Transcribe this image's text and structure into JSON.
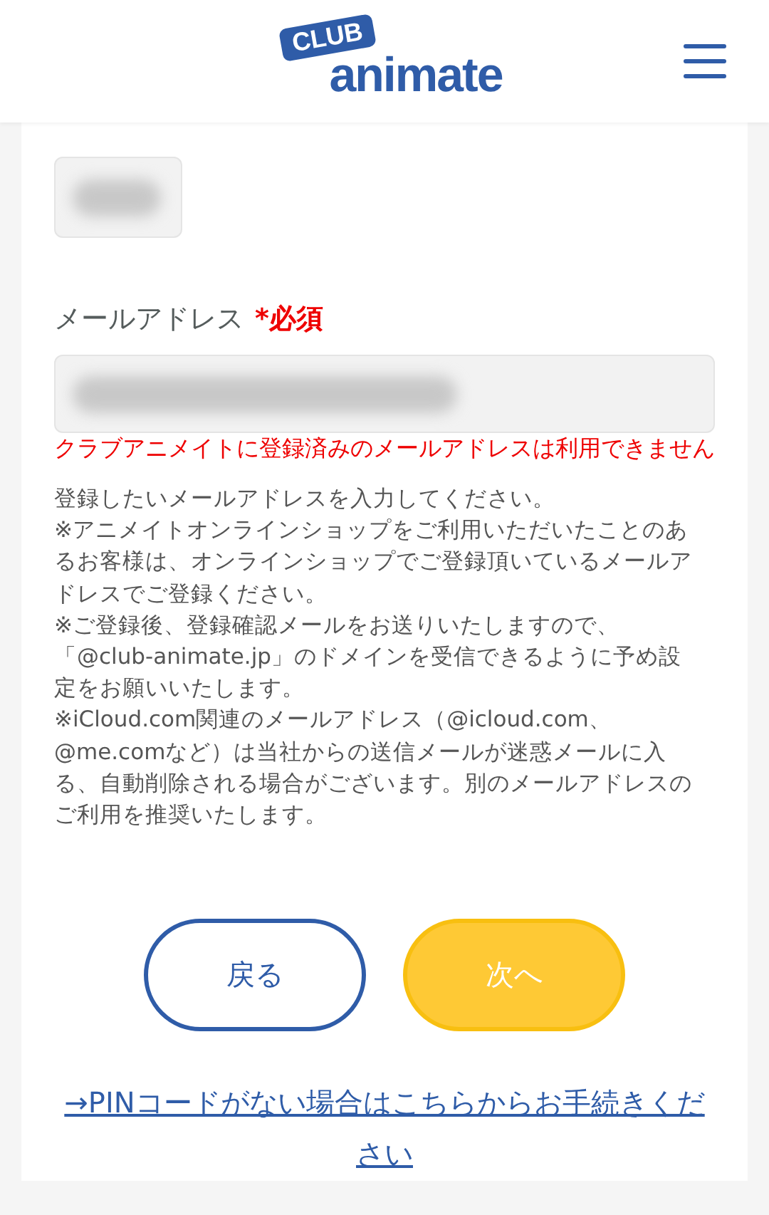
{
  "header": {
    "logo": {
      "badge": "CLUB",
      "word": "animate"
    }
  },
  "pin_field": {
    "filled": true
  },
  "email": {
    "label": "メールアドレス",
    "required": "*必須",
    "filled": true,
    "error": "クラブアニメイトに登録済みのメールアドレスは利用できません"
  },
  "notes": [
    "登録したいメールアドレスを入力してください。",
    "※アニメイトオンラインショップをご利用いただいたことのあるお客様は、オンラインショップでご登録頂いているメールアドレスでご登録ください。",
    "※ご登録後、登録確認メールをお送りいたしますので、「@club-animate.jp」のドメインを受信できるように予め設定をお願いいたします。",
    "※iCloud.com関連のメールアドレス（@icloud.com、@me.comなど）は当社からの送信メールが迷惑メールに入る、自動削除される場合がございます。別のメールアドレスのご利用を推奨いたします。"
  ],
  "buttons": [
    {
      "label": "戻る",
      "kind": "outline"
    },
    {
      "label": "次へ",
      "kind": "primary"
    }
  ],
  "link": "→PINコードがない場合はこちらからお手続きください"
}
